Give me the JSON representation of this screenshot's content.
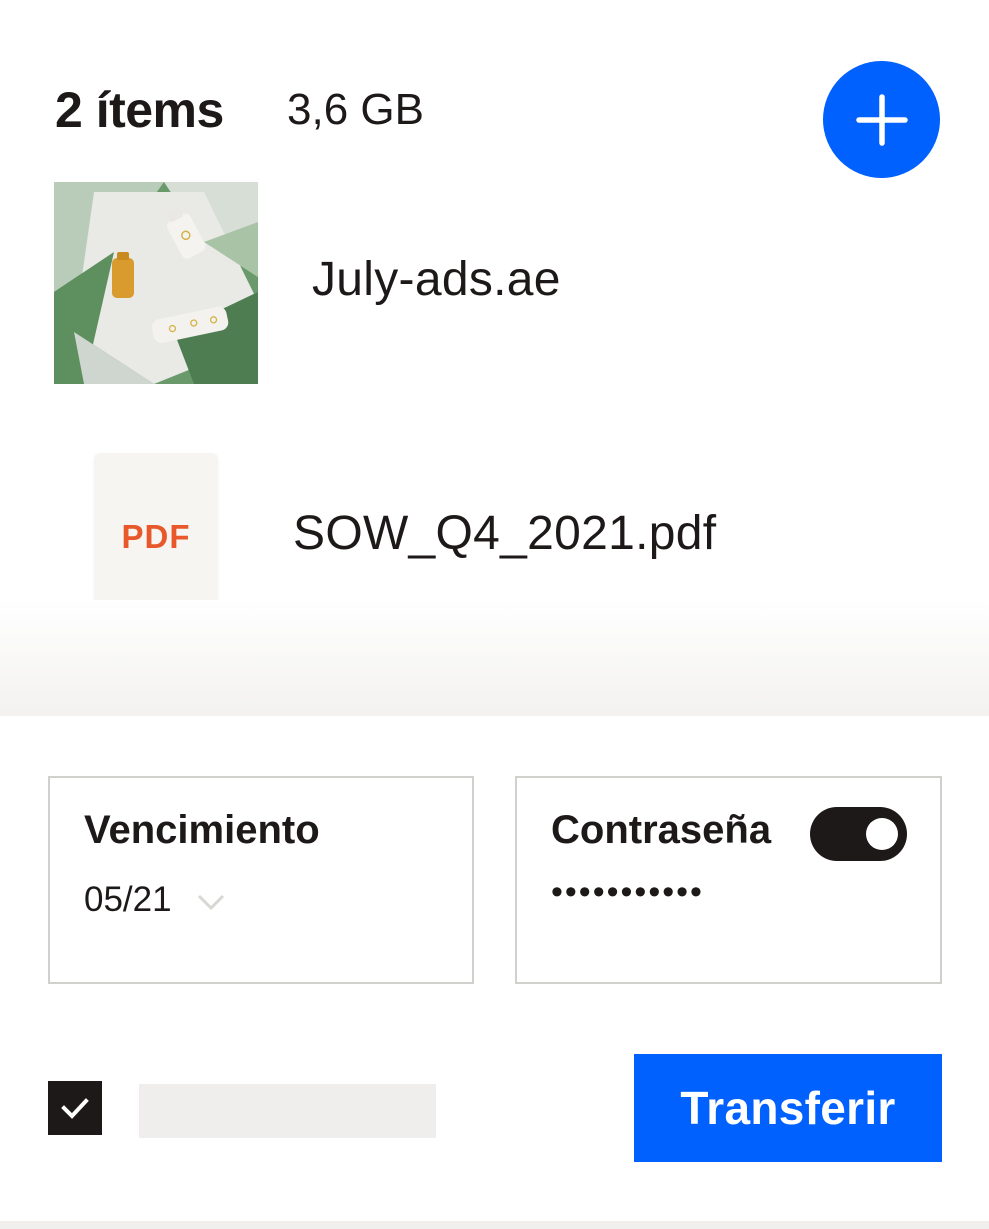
{
  "header": {
    "items_count": "2 ítems",
    "total_size": "3,6 GB",
    "add_icon": "plus-icon"
  },
  "files": [
    {
      "name": "July-ads.ae",
      "thumbnail": "product-bottles-image"
    },
    {
      "name": "SOW_Q4_2021.pdf",
      "thumbnail_label": "PDF"
    }
  ],
  "expiry": {
    "title": "Vencimiento",
    "value": "05/21",
    "dropdown_icon": "chevron-down-icon"
  },
  "password": {
    "title": "Contraseña",
    "toggle_on": true,
    "masked_value": "•••••••••••"
  },
  "footer": {
    "checkbox_checked": true,
    "transfer_label": "Transferir"
  },
  "colors": {
    "accent": "#0061fe",
    "pdf_label": "#e8582b",
    "text": "#1e1919"
  }
}
